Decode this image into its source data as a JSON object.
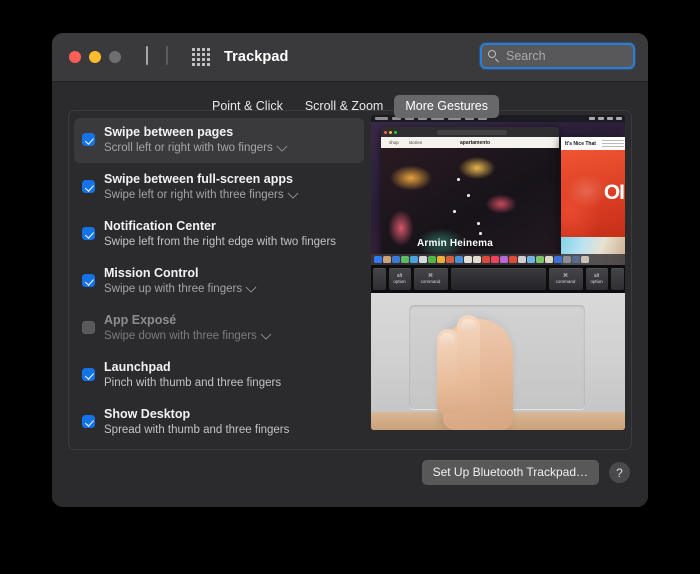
{
  "window": {
    "title": "Trackpad",
    "traffic_lights": [
      "close",
      "minimize",
      "zoom"
    ],
    "nav_back_icon": "chevron-left-icon",
    "nav_forward_icon": "chevron-right-icon",
    "show_all_icon": "grid-icon"
  },
  "search": {
    "placeholder": "Search",
    "icon": "search-icon",
    "value": "",
    "focus_ring_color": "#2a7fd4"
  },
  "tabs": [
    {
      "label": "Point & Click",
      "selected": false
    },
    {
      "label": "Scroll & Zoom",
      "selected": false
    },
    {
      "label": "More Gestures",
      "selected": true
    }
  ],
  "gestures": [
    {
      "title": "Swipe between pages",
      "subtitle": "Scroll left or right with two fingers",
      "checked": true,
      "has_dropdown": true,
      "selected": true,
      "enabled": true
    },
    {
      "title": "Swipe between full-screen apps",
      "subtitle": "Swipe left or right with three fingers",
      "checked": true,
      "has_dropdown": true,
      "selected": false,
      "enabled": true
    },
    {
      "title": "Notification Center",
      "subtitle": "Swipe left from the right edge with two fingers",
      "checked": true,
      "has_dropdown": false,
      "selected": false,
      "enabled": true
    },
    {
      "title": "Mission Control",
      "subtitle": "Swipe up with three fingers",
      "checked": true,
      "has_dropdown": true,
      "selected": false,
      "enabled": true
    },
    {
      "title": "App Exposé",
      "subtitle": "Swipe down with three fingers",
      "checked": false,
      "has_dropdown": true,
      "selected": false,
      "enabled": false
    },
    {
      "title": "Launchpad",
      "subtitle": "Pinch with thumb and three fingers",
      "checked": true,
      "has_dropdown": false,
      "selected": false,
      "enabled": true
    },
    {
      "title": "Show Desktop",
      "subtitle": "Spread with thumb and three fingers",
      "checked": true,
      "has_dropdown": false,
      "selected": false,
      "enabled": true
    }
  ],
  "preview": {
    "description": "gesture-demo-video",
    "browser_nav": [
      "shop",
      "stories"
    ],
    "browser_brand": "apartamento",
    "photo_caption": "Armin Heinema",
    "second_site_logo": "It's Nice That",
    "second_site_big_text": "OI",
    "keyboard_keys": [
      {
        "top": "alt",
        "bottom": "option"
      },
      {
        "top": "⌘",
        "bottom": "command"
      },
      {
        "top": "",
        "bottom": ""
      },
      {
        "top": "⌘",
        "bottom": "command"
      },
      {
        "top": "alt",
        "bottom": "option"
      }
    ]
  },
  "footer": {
    "setup_button": "Set Up Bluetooth Trackpad…",
    "help_button": "?"
  },
  "colors": {
    "accent": "#1473e6",
    "window_bg": "#2b2b2d",
    "titlebar_bg": "#3a3a3c",
    "selected_row_bg": "#3a3a3c"
  }
}
